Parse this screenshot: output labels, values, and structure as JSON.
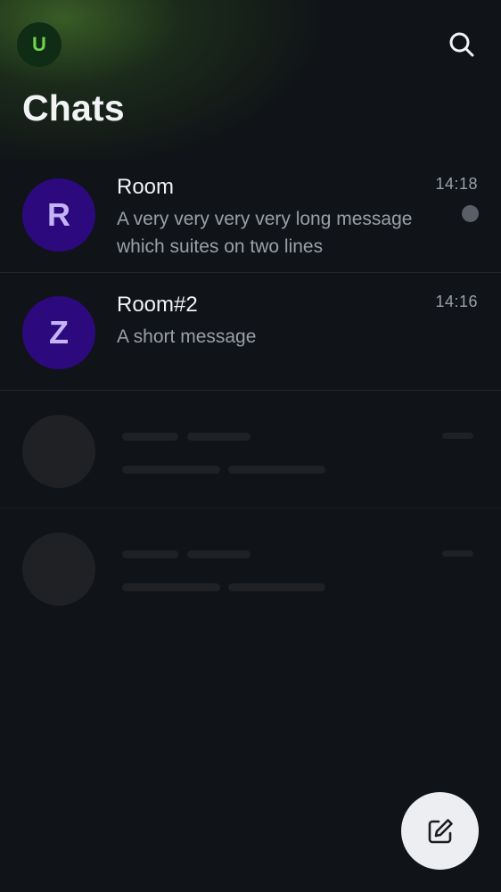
{
  "header": {
    "user_initial": "U",
    "title": "Chats"
  },
  "rooms": [
    {
      "initial": "R",
      "name": "Room",
      "message": "A very very very very long message which suites on two lines",
      "time": "14:18",
      "unread": true
    },
    {
      "initial": "Z",
      "name": "Room#2",
      "message": "A short message",
      "time": "14:16",
      "unread": false
    }
  ],
  "skeleton_rows": 2,
  "icons": {
    "search": "search-icon",
    "compose": "compose-icon"
  },
  "colors": {
    "background": "#101317",
    "room_avatar": "#2c0a7e",
    "user_avatar": "#0f2d14",
    "user_initial": "#6fd24c",
    "fab": "#eceef1"
  }
}
